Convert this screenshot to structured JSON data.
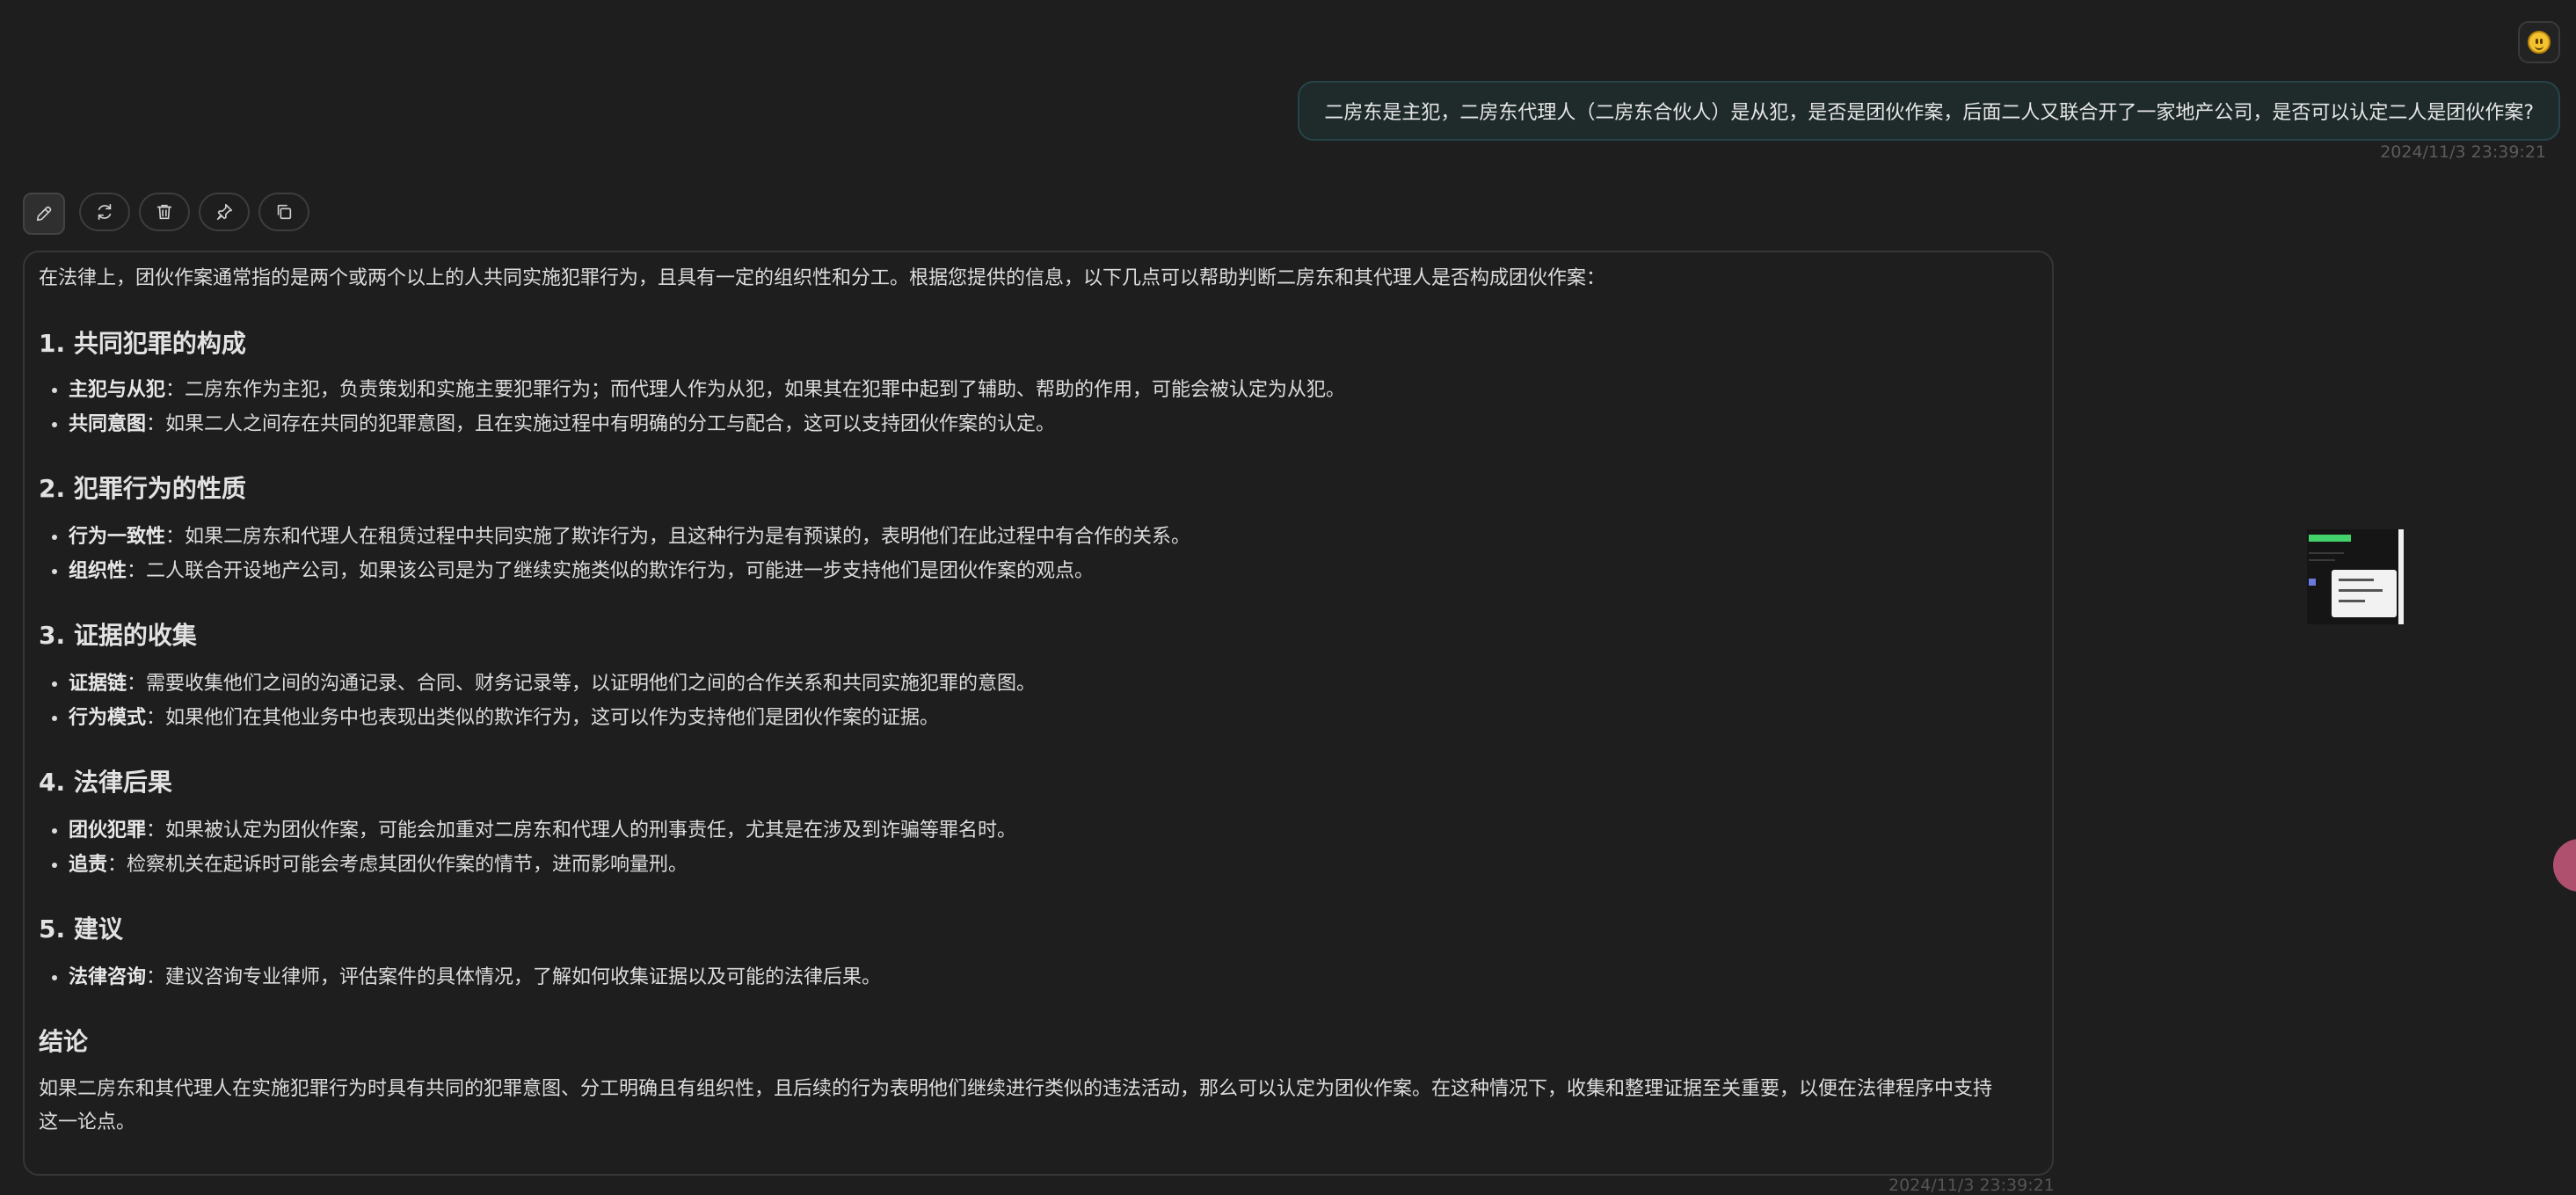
{
  "user_message": {
    "text": "二房东是主犯，二房东代理人（二房东合伙人）是从犯，是否是团伙作案，后面二人又联合开了一家地产公司，是否可以认定二人是团伙作案?",
    "timestamp": "2024/11/3 23:39:21",
    "avatar_icon": "smiley-emoji-icon"
  },
  "toolbar": {
    "buttons": [
      {
        "icon": "edit-icon"
      },
      {
        "icon": "refresh-icon"
      },
      {
        "icon": "delete-icon"
      },
      {
        "icon": "pin-icon"
      },
      {
        "icon": "copy-icon"
      }
    ]
  },
  "answer": {
    "intro": "在法律上，团伙作案通常指的是两个或两个以上的人共同实施犯罪行为，且具有一定的组织性和分工。根据您提供的信息，以下几点可以帮助判断二房东和其代理人是否构成团伙作案：",
    "sections": [
      {
        "heading": "1. 共同犯罪的构成",
        "items": [
          {
            "term": "主犯与从犯",
            "text": "：二房东作为主犯，负责策划和实施主要犯罪行为；而代理人作为从犯，如果其在犯罪中起到了辅助、帮助的作用，可能会被认定为从犯。"
          },
          {
            "term": "共同意图",
            "text": "：如果二人之间存在共同的犯罪意图，且在实施过程中有明确的分工与配合，这可以支持团伙作案的认定。"
          }
        ]
      },
      {
        "heading": "2. 犯罪行为的性质",
        "items": [
          {
            "term": "行为一致性",
            "text": "：如果二房东和代理人在租赁过程中共同实施了欺诈行为，且这种行为是有预谋的，表明他们在此过程中有合作的关系。"
          },
          {
            "term": "组织性",
            "text": "：二人联合开设地产公司，如果该公司是为了继续实施类似的欺诈行为，可能进一步支持他们是团伙作案的观点。"
          }
        ]
      },
      {
        "heading": "3. 证据的收集",
        "items": [
          {
            "term": "证据链",
            "text": "：需要收集他们之间的沟通记录、合同、财务记录等，以证明他们之间的合作关系和共同实施犯罪的意图。"
          },
          {
            "term": "行为模式",
            "text": "：如果他们在其他业务中也表现出类似的欺诈行为，这可以作为支持他们是团伙作案的证据。"
          }
        ]
      },
      {
        "heading": "4. 法律后果",
        "items": [
          {
            "term": "团伙犯罪",
            "text": "：如果被认定为团伙作案，可能会加重对二房东和代理人的刑事责任，尤其是在涉及到诈骗等罪名时。"
          },
          {
            "term": "追责",
            "text": "：检察机关在起诉时可能会考虑其团伙作案的情节，进而影响量刑。"
          }
        ]
      },
      {
        "heading": "5. 建议",
        "items": [
          {
            "term": "法律咨询",
            "text": "：建议咨询专业律师，评估案件的具体情况，了解如何收集证据以及可能的法律后果。"
          }
        ]
      }
    ],
    "conclusion_heading": "结论",
    "conclusion_line1": "如果二房东和其代理人在实施犯罪行为时具有共同的犯罪意图、分工明确且有组织性，且后续的行为表明他们继续进行类似的违法活动，那么可以认定为团伙作案。在这种情况下，收集和整理证据至关重要，以便在法律程序中支持",
    "conclusion_line2": "这一论点。",
    "timestamp": "2024/11/3 23:39:21"
  }
}
